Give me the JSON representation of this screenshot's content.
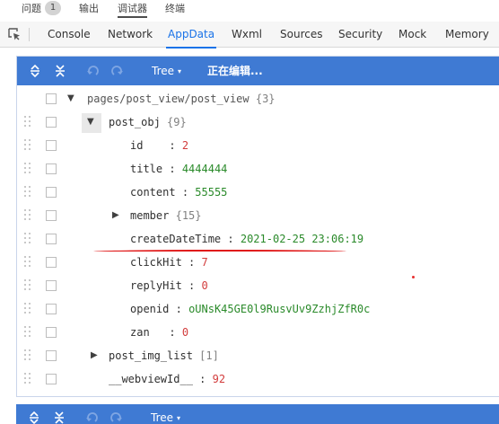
{
  "top_tabs": {
    "problems": "问题",
    "problems_count": "1",
    "output": "输出",
    "debugger": "调试器",
    "terminal": "终端"
  },
  "dev_tabs": [
    "Console",
    "Network",
    "AppData",
    "Wxml",
    "Sources",
    "Security",
    "Mock",
    "Memory"
  ],
  "active_dev_tab": "AppData",
  "toolbar": {
    "mode": "Tree",
    "caret": "▾",
    "status": "正在编辑..."
  },
  "tree": {
    "root_path": "pages/post_view/post_view",
    "root_count": "{3}",
    "post_obj": {
      "key": "post_obj",
      "count": "{9}"
    },
    "fields": [
      {
        "key": "id",
        "pad": "   ",
        "value": "2",
        "kind": "num"
      },
      {
        "key": "title",
        "pad": "",
        "value": "4444444",
        "kind": "str"
      },
      {
        "key": "content",
        "pad": "",
        "value": "55555",
        "kind": "str"
      },
      {
        "key": "member",
        "pad": "",
        "value": "{15}",
        "kind": "meta"
      },
      {
        "key": "createDateTime",
        "pad": "",
        "value": "2021-02-25 23:06:19",
        "kind": "str"
      },
      {
        "key": "clickHit",
        "pad": "",
        "value": "7",
        "kind": "num"
      },
      {
        "key": "replyHit",
        "pad": "",
        "value": "0",
        "kind": "num"
      },
      {
        "key": "openid",
        "pad": "",
        "value": "oUNsK45GE0l9RusvUv9ZzhjZfR0c",
        "kind": "str"
      },
      {
        "key": "zan",
        "pad": "  ",
        "value": "0",
        "kind": "num"
      }
    ],
    "post_img_list": {
      "key": "post_img_list",
      "count": "[1]"
    },
    "webviewId": {
      "key": "__webviewId__",
      "value": "92"
    }
  },
  "colors": {
    "accent": "#3f7ad3",
    "active_tab": "#1a73e8",
    "number": "#d23c3c",
    "string": "#2a8a2a",
    "annotation": "#e01818"
  }
}
